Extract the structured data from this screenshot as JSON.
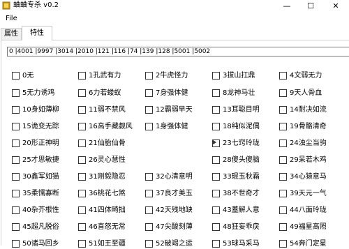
{
  "window": {
    "title": "蛐蛐专杀 v0.2",
    "min": "—",
    "max": "☐",
    "close": "✕"
  },
  "menu": {
    "file": "File"
  },
  "tabs": [
    {
      "label": "属性"
    },
    {
      "label": "特性"
    }
  ],
  "ids_field": {
    "value": "0 |4001 |9997 |3014 |2010 |121 |116 |74 |139 |128 |5001 |5002"
  },
  "colors": {
    "icon": "#d4a017"
  },
  "traits": [
    [
      "0无",
      "1孔武有力",
      "2牛虎怪力",
      "3拔山扛鼎",
      "4文弱无力"
    ],
    [
      "5无力诱鸡",
      "6力若蝼蚁",
      "7身强体健",
      "8龙神马壮",
      "9天人骨血"
    ],
    [
      "10身如薄柳",
      "11弱不禁风",
      "12霸弱早天",
      "13耳聪目明",
      "14耐决如流"
    ],
    [
      "15诡变无踪",
      "16高手藏觑风",
      "1身强体健",
      "18纯似泥偶",
      "19骨骼清奇"
    ],
    [
      "20形正神明",
      "21仙胎仙骨",
      "",
      "23七窍玲珑",
      "24浊尘当驹"
    ],
    [
      "25才思敏捷",
      "26灵心慧性",
      "",
      "28傻头傻脑",
      "29呆若木鸡"
    ],
    [
      "30鑫军如猫",
      "31刚毅隐忍",
      "32心清意明",
      "33琨玉秋霜",
      "34心猿意马"
    ],
    [
      "35柔懦寡断",
      "36桃花七煞",
      "37良才美玉",
      "38不世奇才",
      "39天元一气"
    ],
    [
      "40杂芥根性",
      "41四体畸拙",
      "42天残地缺",
      "43蓋解人意",
      "44八面玲珑"
    ],
    [
      "45超凡脱俗",
      "46喜怒无常",
      "47尖酸刻薄",
      "48狂妄乖戾",
      "49福星高照"
    ],
    [
      "50诸马回乡",
      "51如王至疆",
      "52破竭之运",
      "53球马采马",
      "54奔门定星"
    ]
  ]
}
